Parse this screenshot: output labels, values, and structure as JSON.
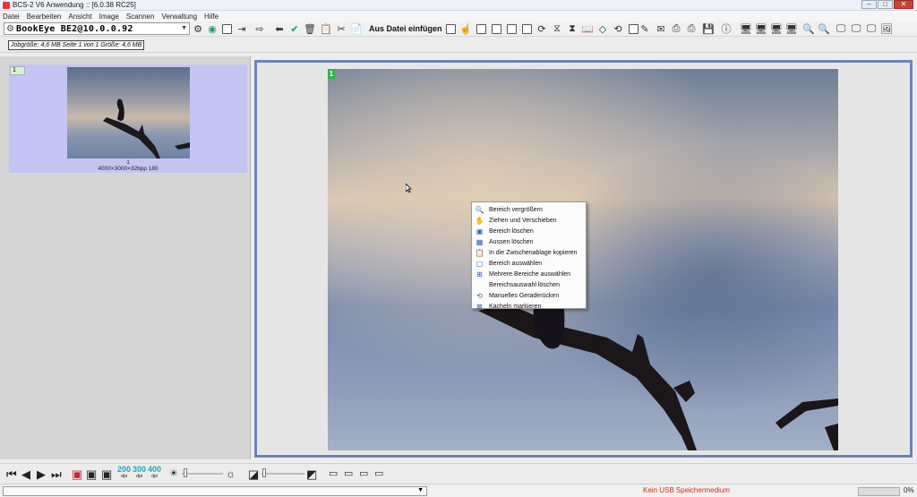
{
  "window": {
    "title": "BCS-2 V6 Anwendung :: [6.0.38 RC25]",
    "controls": {
      "minimize": "–",
      "maximize": "□",
      "close": "✕"
    }
  },
  "menu": [
    "Datei",
    "Bearbeiten",
    "Ansicht",
    "Image",
    "Scannen",
    "Verwaltung",
    "Hilfe"
  ],
  "toolbar": {
    "device": "BookEye BE2@10.0.0.92",
    "import_label": "Aus Datei einfügen"
  },
  "jobinfo": "Jobgröße: 4,6 MB Seite 1 von 1 Größe: 4,6 MB",
  "thumbnail": {
    "number": "1",
    "page_label": "1",
    "meta": "4000×3000×32bpp 180"
  },
  "viewer": {
    "page_badge": "1"
  },
  "context_menu": [
    {
      "label": "Bereich vergrößern",
      "icon": "zoom-icon"
    },
    {
      "label": "Ziehen und Verschieben",
      "icon": "hand-icon"
    },
    {
      "label": "Bereich löschen",
      "icon": "clear-area-icon"
    },
    {
      "label": "Aussen löschen",
      "icon": "clear-outside-icon"
    },
    {
      "label": "In die Zwischenablage kopieren",
      "icon": "clipboard-icon"
    },
    {
      "label": "Bereich auswählen",
      "icon": "select-area-icon"
    },
    {
      "label": "Mehrere Bereiche auswählen",
      "icon": "multi-select-icon"
    },
    {
      "label": "Bereichsauswahl löschen",
      "icon": ""
    },
    {
      "label": "Manuelles Geraderücken",
      "icon": "deskew-icon"
    },
    {
      "label": "Kacheln markieren",
      "icon": "tiles-icon"
    }
  ],
  "bottom": {
    "dpi": [
      {
        "value": "200",
        "unit": "dpi"
      },
      {
        "value": "300",
        "unit": "dpi"
      },
      {
        "value": "400",
        "unit": "dpi"
      }
    ]
  },
  "status": {
    "usb": "Kein USB Speichermedium",
    "progress": "0%",
    "progress_value": 0
  },
  "colors": {
    "accent": "#6b83bc",
    "dpi": "#16a8b8",
    "selection": "#c5c5f3",
    "warning": "#d42a1f"
  }
}
